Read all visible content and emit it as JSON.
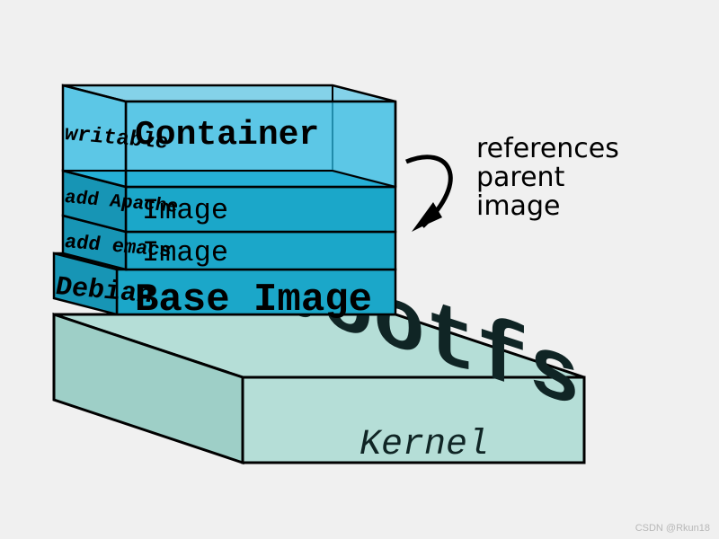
{
  "layers": {
    "kernel_big": "bootfs",
    "kernel_small": "Kernel",
    "base_left": "Debian",
    "base_right": "Base Image",
    "emacs_left": "add emacs",
    "emacs_right": "Image",
    "apache_left": "add Apache",
    "apache_right": "Image",
    "writable_left": "writable",
    "writable_right": "Container"
  },
  "annotation": {
    "line1": "references",
    "line2": "parent",
    "line3": "image"
  },
  "watermark": "CSDN @Rkun18",
  "colors": {
    "kernel_fill": "#b5ded7",
    "layer_fill": "#1ba7c9",
    "top_fill": "#2bb9e3",
    "stroke": "#000000"
  }
}
